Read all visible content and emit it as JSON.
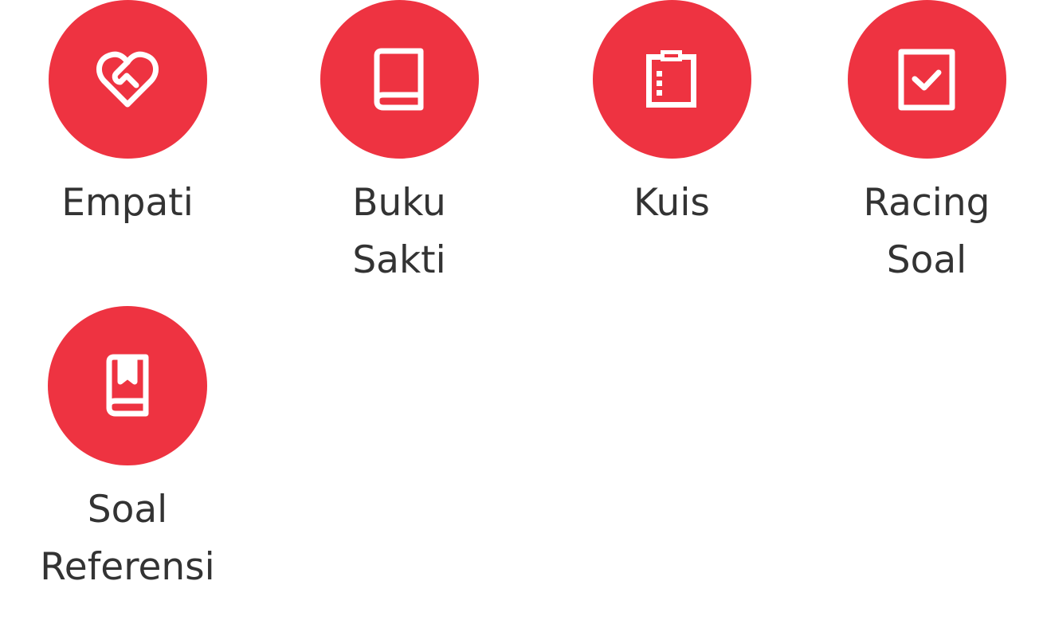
{
  "theme": {
    "accent": "#ee3341",
    "text": "#333333",
    "background": "#ffffff"
  },
  "menu": {
    "items": [
      {
        "label": "Empati",
        "icon": "heart-handshake-icon"
      },
      {
        "label": "Buku\nSakti",
        "icon": "book-icon"
      },
      {
        "label": "Kuis",
        "icon": "clipboard-list-icon"
      },
      {
        "label": "Racing\nSoal",
        "icon": "checkbox-icon"
      },
      {
        "label": "Soal\nReferensi",
        "icon": "bookmark-book-icon"
      }
    ]
  }
}
